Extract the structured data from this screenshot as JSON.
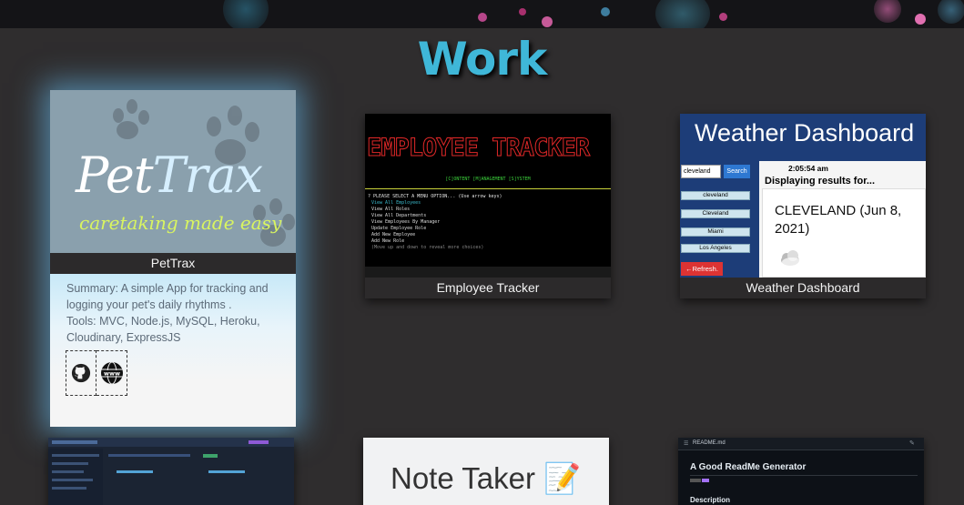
{
  "section": {
    "title": "Work"
  },
  "projects": [
    {
      "caption": "PetTrax",
      "logo_pet": "Pet",
      "logo_trax": "Trax",
      "tagline": "caretaking made easy",
      "summary": "Summary: A simple App for tracking and logging your pet's daily rhythms .",
      "tools": "Tools: MVC, Node.js, MySQL, Heroku, Cloudinary, ExpressJS",
      "links": [
        {
          "icon": "github-icon"
        },
        {
          "icon": "www-icon"
        }
      ]
    },
    {
      "caption": "Employee Tracker",
      "banner": "EMPLOYEE TRACKER",
      "subtitle": "[C]ONTENT [M]ANAGEMENT [S]YSTEM",
      "prompt": "? PLEASE SELECT A MENU OPTION... (Use arrow keys)",
      "menu": [
        "View All Employees",
        "View All Roles",
        "View All Departments",
        "View Employees By Manager",
        "Update Employee Role",
        "Add New Employee",
        "Add New Role"
      ],
      "footer": "(Move up and down to reveal more choices)"
    },
    {
      "caption": "Weather Dashboard",
      "header": "Weather Dashboard",
      "search_value": "cleveland",
      "search_button": "Search",
      "time": "2:05:54 am",
      "displaying": "Displaying results for...",
      "city": "CLEVELAND (Jun 8, 2021)",
      "history": [
        "cleveland",
        "Cleveland",
        "Miami",
        "Los Angeles"
      ],
      "refresh": "←Refresh."
    },
    {
      "caption": ""
    },
    {
      "title": "Note Taker 📝"
    },
    {
      "file": "README.md",
      "heading": "A Good ReadMe Generator",
      "description": "Description"
    }
  ]
}
